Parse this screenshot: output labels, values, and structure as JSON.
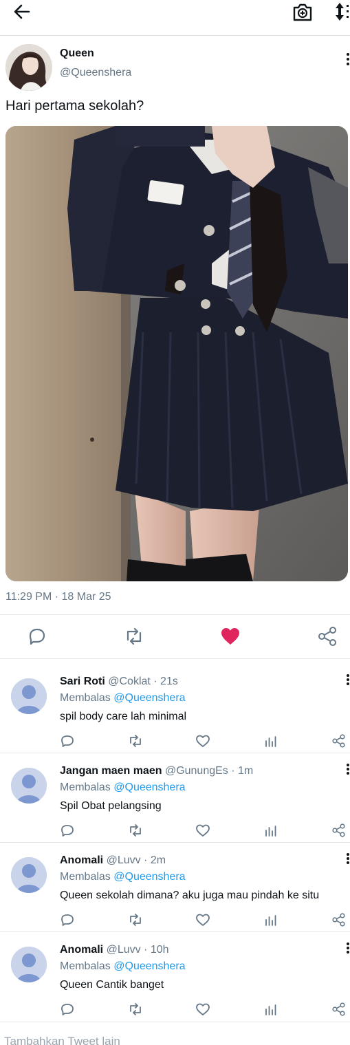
{
  "header": {
    "back_icon": "arrow-left-icon",
    "camera_icon": "camera-plus-icon",
    "sort_icon": "sort-arrows-icon"
  },
  "tweet": {
    "author_name": "Queen",
    "author_handle": "@Queenshera",
    "text": "Hari pertama sekolah?",
    "timestamp": "11:29 PM · 18 Mar 25",
    "liked": true,
    "like_color": "#e0245e"
  },
  "replies": [
    {
      "name": "Sari Roti",
      "meta": " @Coklat · 21s",
      "replying_label": "Membalas ",
      "replying_to": "@Queenshera",
      "text": "spil body care lah minimal"
    },
    {
      "name": "Jangan maen maen",
      "meta": " @GunungEs · 1m",
      "replying_label": "Membalas ",
      "replying_to": "@Queenshera",
      "text": "Spil Obat pelangsing"
    },
    {
      "name": "Anomali",
      "meta": " @Luvv · 2m",
      "replying_label": "Membalas ",
      "replying_to": "@Queenshera",
      "text": "Queen sekolah dimana? aku juga mau pindah ke situ"
    },
    {
      "name": "Anomali",
      "meta": " @Luvv · 10h",
      "replying_label": "Membalas ",
      "replying_to": "@Queenshera",
      "text": "Queen Cantik banget"
    }
  ],
  "compose": {
    "placeholder": "Tambahkan Tweet lain"
  },
  "colors": {
    "accent": "#1d9bf0",
    "secondary_text": "#657786",
    "icon": "#657786",
    "like": "#e0245e",
    "avatar_default": "#7d97d1"
  }
}
